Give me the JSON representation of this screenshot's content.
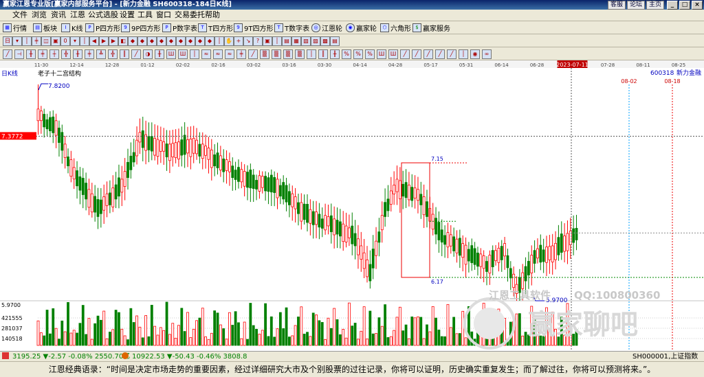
{
  "window": {
    "title": "赢家江恩专业版[赢家内部服务平台] - [新力金融  SH600318-184日K线]",
    "links": [
      "客服",
      "论坛",
      "主页"
    ],
    "buttons": [
      "_",
      "□",
      "×"
    ]
  },
  "menu": [
    "文件",
    "浏览",
    "资讯",
    "江恩",
    "公式选股",
    "设置",
    "工具",
    "窗口",
    "交易委托",
    "帮助"
  ],
  "toolbar1": [
    "行情",
    "板块",
    "K线",
    "P四方形",
    "9P四方形",
    "P数字表",
    "T四方形",
    "9T四方形",
    "T数字表",
    "江恩轮",
    "赢家轮",
    "六角形",
    "赢家服务"
  ],
  "chart": {
    "timeframe": "日K线",
    "indicator_label": "老子十二宫结构",
    "stock_code": "600318",
    "stock_name": "新力金融",
    "dates": [
      "11-30",
      "12-14",
      "12-28",
      "01-12",
      "02-02",
      "02-16",
      "03-02",
      "03-16",
      "03-30",
      "04-14",
      "04-28",
      "05-17",
      "05-31",
      "06-14",
      "06-28",
      "2023-07-11",
      "07-28",
      "08-11",
      "08-25"
    ],
    "cursor_date": "2023-07-11",
    "cursor_price": "7.3772",
    "high_label": "7.8200",
    "low_label": "5.9700",
    "box_top": "7.15",
    "box_bottom": "6.17",
    "axis_low": "5.9700",
    "future_lines": [
      "08-02",
      "08-18"
    ],
    "volume_ticks": [
      "421555",
      "281037",
      "140518"
    ],
    "watermark_software": "江恩工具软件",
    "watermark_qq": "QQ:100800360",
    "watermark_brand": "赢家聊吧",
    "colors": {
      "up": "#ff0000",
      "down": "#008000",
      "bg": "#ffffff",
      "cursor": "#ff0000",
      "accent": "#0000c0"
    }
  },
  "tickers": [
    {
      "text": "3195.25 ▼-2.57 -0.08% 2550.70亿",
      "color": "#008000"
    },
    {
      "text": "10922.53 ▼-50.43 -0.46% 3808.8",
      "color": "#008000"
    },
    {
      "text": "SH000001,上证指数",
      "color": "#000000"
    }
  ],
  "quote": "江恩经典语录：“时间是决定市场走势的重要因素，经过详细研究大市及个别股票的过往记录，你将可以证明，历史确实重复发生；而了解过往，你将可以预测将来。”。"
}
